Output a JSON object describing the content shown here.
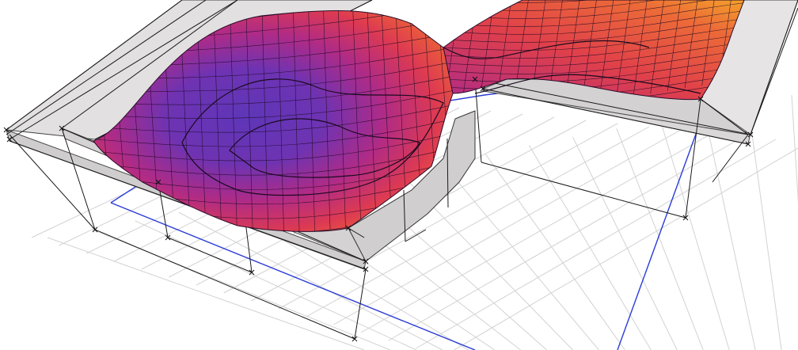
{
  "viewport": {
    "background": "#ffffff"
  },
  "colors": {
    "floor_grid": "#cfcfcf",
    "frame_line": "#111111",
    "frame_fill": "#d8d6d6",
    "frame_fill_light": "#ecebeb",
    "outline_blue": "#2a3bd6",
    "surface_low": "#6a34b8",
    "surface_mid": "#c02a78",
    "surface_high": "#e8523a",
    "surface_peak": "#f29a2a"
  }
}
